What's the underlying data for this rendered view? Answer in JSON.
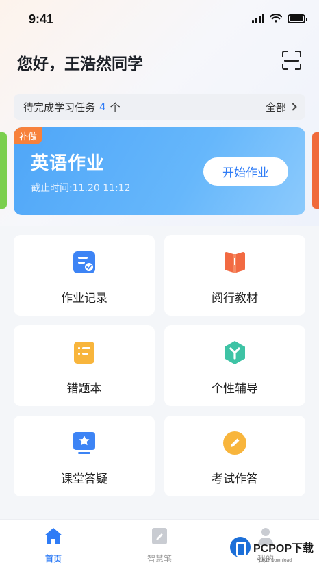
{
  "status": {
    "time": "9:41"
  },
  "header": {
    "greeting": "您好，王浩然同学"
  },
  "tasks": {
    "label": "待完成学习任务",
    "count": "4",
    "unit": "个",
    "all": "全部"
  },
  "homework": {
    "tag": "补做",
    "title": "英语作业",
    "deadline": "截止时间:11.20 11:12",
    "start": "开始作业"
  },
  "tiles": [
    {
      "label": "作业记录",
      "icon": "homework-record-icon",
      "color": "#3d84f5"
    },
    {
      "label": "阅行教材",
      "icon": "textbook-icon",
      "color": "#f26a42"
    },
    {
      "label": "错题本",
      "icon": "mistake-book-icon",
      "color": "#f8b53c"
    },
    {
      "label": "个性辅导",
      "icon": "tutoring-icon",
      "color": "#3ec3a5"
    },
    {
      "label": "课堂答疑",
      "icon": "class-qa-icon",
      "color": "#3d84f5"
    },
    {
      "label": "考试作答",
      "icon": "exam-icon",
      "color": "#f8b53c"
    }
  ],
  "tabs": [
    {
      "label": "首页",
      "icon": "home-icon",
      "active": true
    },
    {
      "label": "智慧笔",
      "icon": "smart-pen-icon",
      "active": false
    },
    {
      "label": "我的",
      "icon": "profile-icon",
      "active": false
    }
  ],
  "watermark": {
    "text": "PCPOP下载",
    "sub": "PCPOP Download"
  },
  "colors": {
    "accent": "#2f7cf6",
    "tag": "#f7813b"
  }
}
